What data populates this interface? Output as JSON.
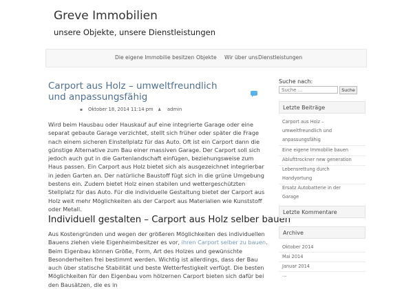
{
  "site": {
    "title": "Greve Immobilien",
    "description": "unsere Objekte, unsere Dienstleistungen"
  },
  "nav": {
    "items": [
      "Die eigene Immobilie besitzen",
      "Objekte",
      "Wir über uns",
      "Dienstleistungen"
    ]
  },
  "post": {
    "title_line1": "Carport aus Holz – umweltfreundlich",
    "title_line2": "und anpassungsfähig",
    "date": "Oktober 18, 2014 11:14 pm",
    "author": "admin",
    "paragraph1": "Wird beim Hausbau oder Hauskauf auf eine integrierte Garage oder eine separat gebaute Garage verzichtet, stellt sich früher oder später die Frage nach einem sicheren Einstellplatz für das Auto. Oft ist ein Carport dann die günstige Alternative zum Bau einer massiven Garage. Der Carport soll sich jedoch auch gut in die Gartenlandschaft einfügen, beziehungsweise zum Haus passen. Ein Carport aus Holz bietet sich als ausgezeichnet integrierbar in jeden Garten an. Der natürliche Baustoff fügt sich in die grüne Umgebung bestens ein. Zudem bietet Holz einen stabilen und wettergeschützten Stellplatz für das Auto. Für die individuelle Gestaltung bietet der Carport aus Holz weit mehr Möglichkeiten als der Carport aus Materialien wie Kunststoff oder Metall.",
    "section_heading": "Individuell gestalten – Carport aus Holz selber bauen",
    "paragraph2_before_link": "Aus Kostengründen und wegen der größeren Möglichkeiten des individuellen Bauens ziehen viele Eigenheimbesitzer es vor, ",
    "paragraph2_link": "ihren Carport selber zu bauen",
    "paragraph2_after_link": ". Beim Eigenbau können Größe, Form, Art des Holzes und gewünschte Besonderheiten frei bestimmt werden. Wichtig ist allerdings, dass der Bau auch über statische Stabilität und beste Wetterfestigkeit verfügt. Die besten Möglichkeiten für den Eigenbau vom hölzernen Carport bieten sich dafür bei den Bausätzen, die es in"
  },
  "sidebar": {
    "search_label": "Suche nach:",
    "search_placeholder": "Suche ...",
    "search_button": "Suche",
    "recent_posts_title": "Letzte Beiträge",
    "recent_posts": [
      "Carport aus Holz –",
      "umweltfreundlich und",
      "anpassungsfähig",
      "Eine eigene Immobilie bauen",
      "Ablufttrockner new generation",
      "Lebensrettung durch",
      "Handyortung",
      "Ersatz Autobatterie in der",
      "Garage"
    ],
    "recent_comments_title": "Letzte Kommentare",
    "archive_title": "Archive",
    "archive_items": [
      "Oktober 2014",
      "Mai 2014",
      "Januar 2014",
      "..."
    ]
  },
  "colors": {
    "post_title": "#4f6f8f",
    "link": "#7a9ab5",
    "comment_bubble": "#5ab3e6"
  }
}
